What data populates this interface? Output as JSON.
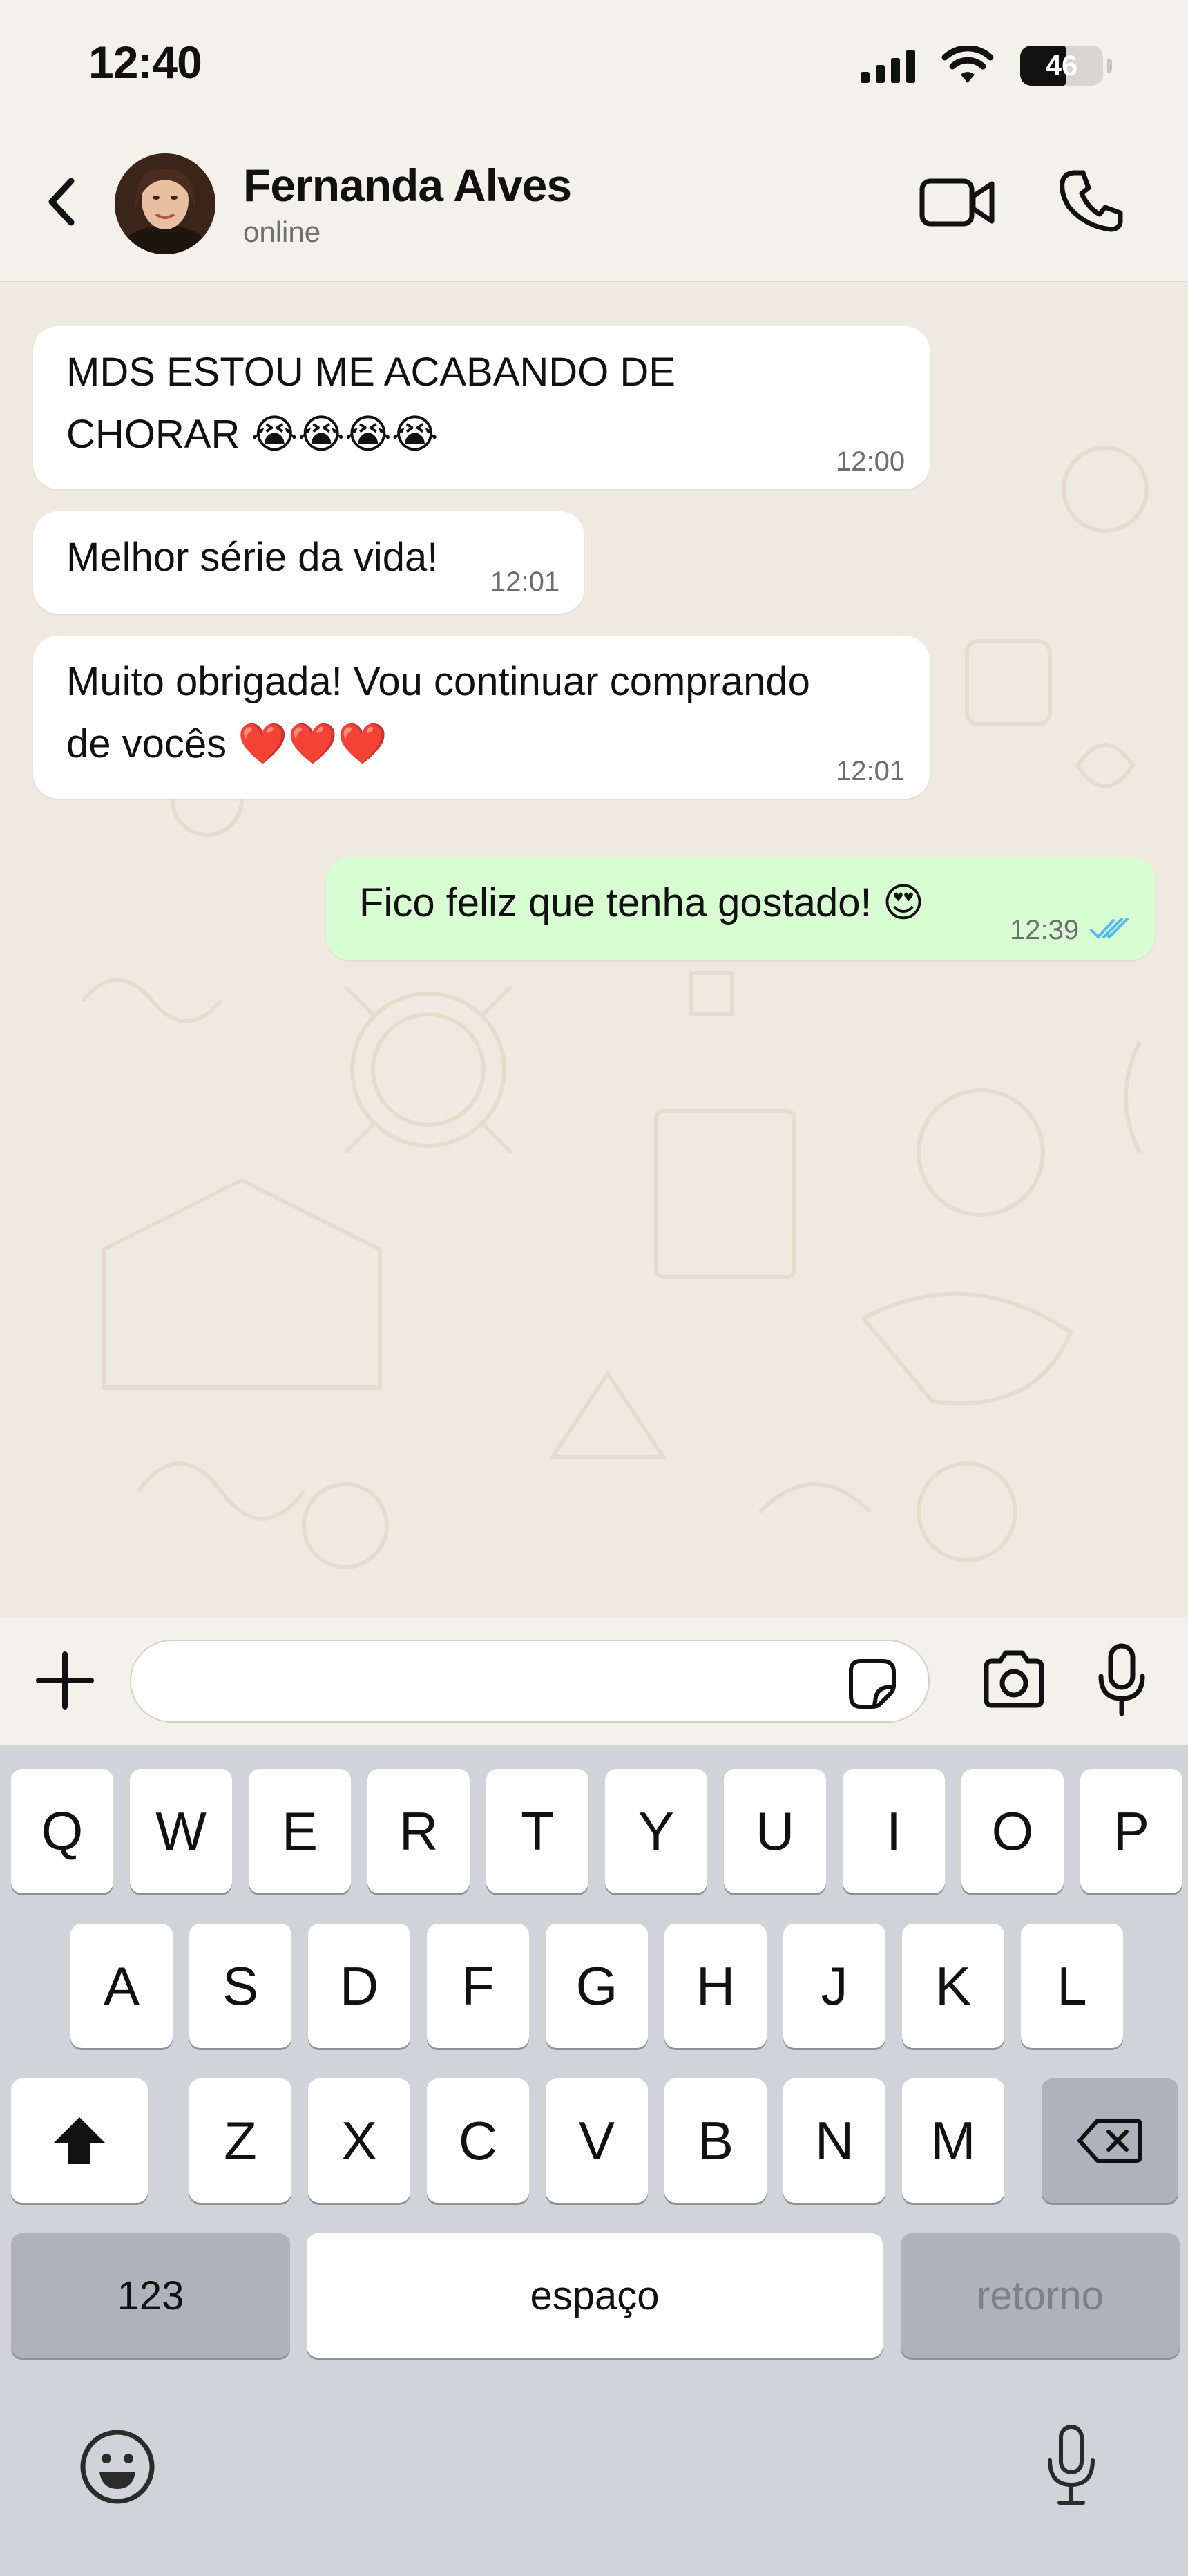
{
  "status_bar": {
    "time": "12:40",
    "battery_level": "46"
  },
  "header": {
    "contact_name": "Fernanda Alves",
    "contact_status": "online"
  },
  "messages": [
    {
      "direction": "incoming",
      "lines": [
        "MDS ESTOU ME ACABANDO DE",
        "CHORAR 😭😭😭😭"
      ],
      "time": "12:00"
    },
    {
      "direction": "incoming",
      "lines": [
        "Melhor série da vida!"
      ],
      "time": "12:01"
    },
    {
      "direction": "incoming",
      "lines": [
        "Muito obrigada! Vou continuar comprando",
        "de vocês ❤️❤️❤️"
      ],
      "time": "12:01"
    },
    {
      "direction": "outgoing",
      "lines": [
        "Fico feliz que tenha gostado! 😍"
      ],
      "time": "12:39",
      "read": true
    }
  ],
  "input": {
    "value": "",
    "placeholder": ""
  },
  "keyboard": {
    "row1": [
      "Q",
      "W",
      "E",
      "R",
      "T",
      "Y",
      "U",
      "I",
      "O",
      "P"
    ],
    "row2": [
      "A",
      "S",
      "D",
      "F",
      "G",
      "H",
      "J",
      "K",
      "L"
    ],
    "row3": [
      "Z",
      "X",
      "C",
      "V",
      "B",
      "N",
      "M"
    ],
    "numbers_label": "123",
    "space_label": "espaço",
    "return_label": "retorno"
  },
  "icons": {
    "back": "chevron-left-icon",
    "video": "video-camera-icon",
    "call": "phone-icon",
    "plus": "plus-icon",
    "sticker": "sticker-icon",
    "camera": "camera-icon",
    "mic": "microphone-icon",
    "read_receipt": "double-check-icon",
    "shift": "shift-icon",
    "backspace": "backspace-icon",
    "emoji": "emoji-icon"
  },
  "colors": {
    "background": "#f4f1ea",
    "chat_wallpaper": "#efeae0",
    "incoming_bubble": "#ffffff",
    "outgoing_bubble": "#d9fdd3",
    "read_ticks": "#53bdeb",
    "keyboard_bg": "#d1d3d9"
  }
}
